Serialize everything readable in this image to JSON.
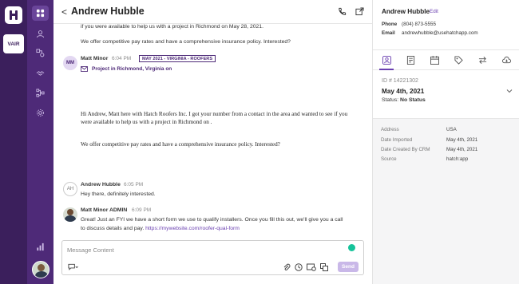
{
  "org_badge": "VAIR",
  "conversation": {
    "contact_name": "Andrew Hubble",
    "back_symbol": "<",
    "truncated_top": {
      "line1": "if you were available to help us with a project in Richmond on May 28, 2021.",
      "line2": "We offer competitive pay rates and have a comprehensive insurance policy. Interested?"
    },
    "email_msg": {
      "avatar_initials": "MM",
      "sender": "Matt Minor",
      "time": "6:04 PM",
      "tag": "MAY 2021 - VIRGINIA - ROOFERS",
      "project": "Project in Richmond, Virginia on",
      "body_line1": "Hi Andrew, Matt here with Hatch Roofers Inc. I got your number from a contact in the area and wanted to see if you",
      "body_line2": "were available to help us with a project in Richmond on .",
      "body_line3": "We offer competitive pay rates and have a comprehensive insurance policy. Interested?"
    },
    "reply_msg": {
      "avatar_initials": "AH",
      "sender": "Andrew Hubble",
      "time": "6:05 PM",
      "text": "Hey there, definitely interested."
    },
    "admin_msg": {
      "sender": "Matt Minor ADMIN",
      "time": "6:09 PM",
      "line1": "Great! Just an FYI we have a short form we use to qualify installers. Once you fill this out, we'll give you a call",
      "line2_prefix": "to discuss details and pay. ",
      "link": "https://mywebsite.com/roofer-qual-form"
    },
    "composer": {
      "placeholder": "Message Content",
      "send_label": "Send"
    }
  },
  "panel": {
    "name": "Andrew Hubble",
    "edit_label": "Edit",
    "phone_label": "Phone",
    "phone": "(804) 873-5555",
    "email_label": "Email",
    "email": "andrewhubble@usehatchapp.com",
    "id_text": "ID # 14221302",
    "date": "May 4th, 2021",
    "status_prefix": "Status: ",
    "status_value": "No Status",
    "details": [
      {
        "key": "Address",
        "value": "USA"
      },
      {
        "key": "Date Imported",
        "value": "May 4th, 2021"
      },
      {
        "key": "Date Created By CRM",
        "value": "May 4th, 2021"
      },
      {
        "key": "Source",
        "value": "hatch:app"
      }
    ]
  },
  "colors": {
    "rail": "#3b1f5c",
    "nav": "#4e2a78",
    "accent": "#6a3fb0",
    "send_disabled": "#c9b8e8"
  }
}
